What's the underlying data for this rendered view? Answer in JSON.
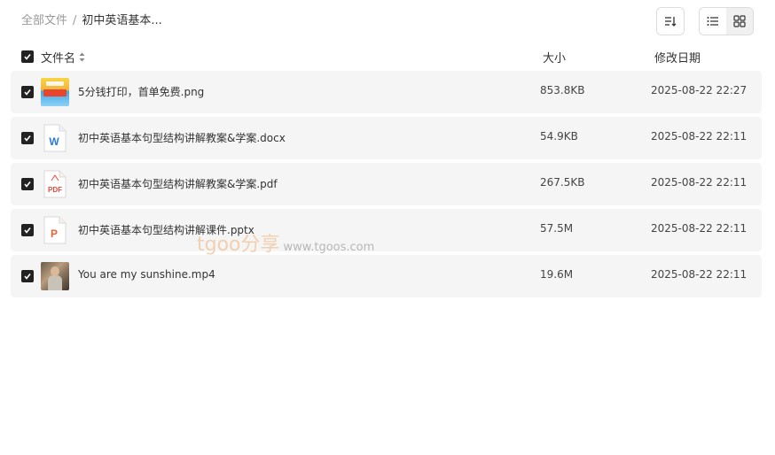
{
  "breadcrumb": {
    "root": "全部文件",
    "separator": "/",
    "current": "初中英语基本..."
  },
  "toolbar": {
    "sort_icon": "sort-icon",
    "view_modes": [
      {
        "name": "list",
        "icon": "list-view-icon",
        "active": false
      },
      {
        "name": "grid",
        "icon": "grid-view-icon",
        "active": true
      }
    ]
  },
  "table": {
    "columns": {
      "name": "文件名",
      "size": "大小",
      "date": "修改日期"
    },
    "select_all_checked": true,
    "rows": [
      {
        "name": "5分钱打印，首单免费.png",
        "size": "853.8KB",
        "date": "2025-08-22 22:27",
        "type": "image",
        "checked": true
      },
      {
        "name": "初中英语基本句型结构讲解教案&学案.docx",
        "size": "54.9KB",
        "date": "2025-08-22 22:11",
        "type": "word",
        "checked": true
      },
      {
        "name": "初中英语基本句型结构讲解教案&学案.pdf",
        "size": "267.5KB",
        "date": "2025-08-22 22:11",
        "type": "pdf",
        "checked": true
      },
      {
        "name": "初中英语基本句型结构讲解课件.pptx",
        "size": "57.5M",
        "date": "2025-08-22 22:11",
        "type": "ppt",
        "checked": true
      },
      {
        "name": "You are my sunshine.mp4",
        "size": "19.6M",
        "date": "2025-08-22 22:11",
        "type": "video",
        "checked": true
      }
    ]
  },
  "watermark": {
    "brand": "tgoo分享",
    "url": "www.tgoos.com"
  },
  "colors": {
    "row_background": "#f5f5f5",
    "checkbox": "#222222",
    "word_blue": "#2b7cd3",
    "pdf_red": "#e8473c",
    "ppt_orange": "#e8633a"
  }
}
